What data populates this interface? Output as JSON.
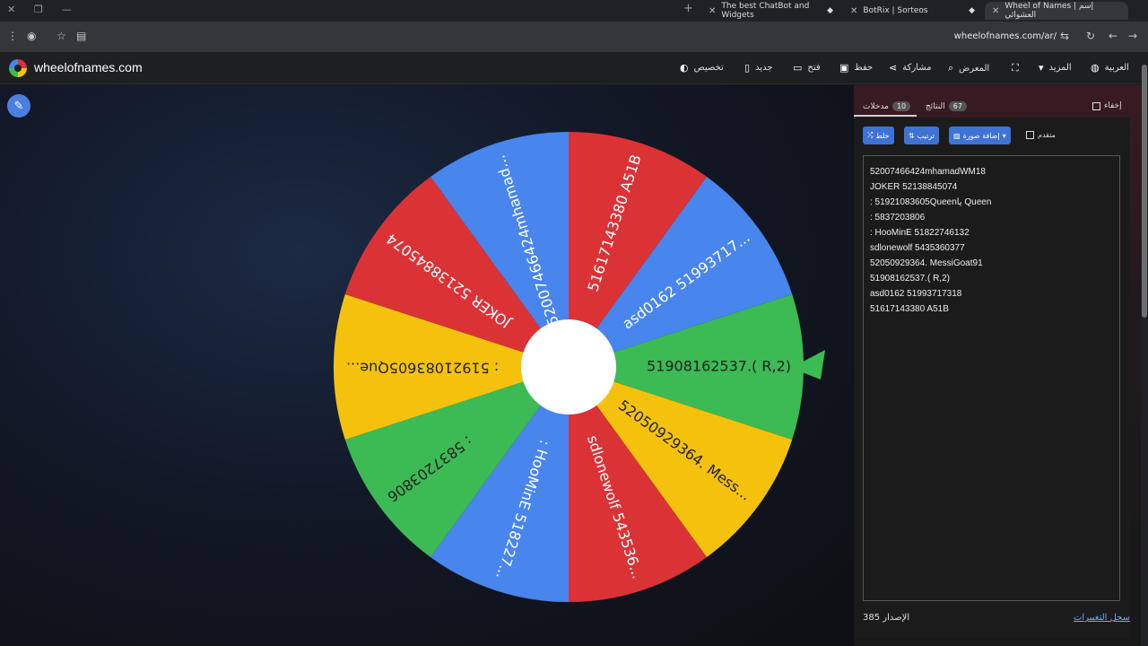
{
  "browser": {
    "tabs": [
      {
        "title": "The best ChatBot and Widgets"
      },
      {
        "title": "BotRix | Sorteos"
      },
      {
        "title": "Wheel of Names | إسم العشوائي"
      }
    ],
    "url": "wheelofnames.com/ar/"
  },
  "site": {
    "name": "wheelofnames.com",
    "nav": {
      "language": "العربية",
      "more": "المزيد",
      "gallery": "المعرض",
      "share": "مشاركة",
      "save": "حفظ",
      "open": "فتح",
      "new": "جديد",
      "customize": "تخصيص"
    }
  },
  "panel": {
    "hide_label": "إخفاء",
    "results_tab": "النتائج",
    "results_count": "67",
    "entries_tab": "مدخلات",
    "entries_count": "10",
    "advanced_label": "متقدم",
    "add_image_label": "إضافة صورة",
    "sort_label": "ترتيب",
    "shuffle_label": "خلط",
    "entries": [
      "52007466424mhamadWM18",
      "JOKER 52138845074",
      ": 51921083605Queenيا Queen",
      ": 5837203806",
      ": HooMinE 51822746132",
      "sdlonewolf 5435360377",
      "52050929364. MessiGoat91",
      "51908162537.( R,2)",
      "asd0162 51993717318",
      "51617143380 A51B"
    ],
    "version_label": "الإصدار",
    "version_number": "385",
    "changelog_label": "سجل التغييرات"
  },
  "wheel": {
    "segments": [
      {
        "label": "51908162537.( R,2)",
        "color": "#3cba54"
      },
      {
        "label": "52050929364. Mess...",
        "color": "#f4c20d"
      },
      {
        "label": "sdlonewolf 543536...",
        "color": "#db3236"
      },
      {
        "label": ": HooMinE 518227...",
        "color": "#4885ed"
      },
      {
        "label": ": 5837203806",
        "color": "#3cba54"
      },
      {
        "label": ": 51921083605Que...",
        "color": "#f4c20d"
      },
      {
        "label": "JOKER 52138845074",
        "color": "#db3236"
      },
      {
        "label": "52007466424mhamad...",
        "color": "#4885ed"
      },
      {
        "label": "51617143380 A51B",
        "color": "#db3236"
      },
      {
        "label": "asd0162 51993717...",
        "color": "#4885ed"
      }
    ],
    "pointer_color": "#3cba54"
  }
}
